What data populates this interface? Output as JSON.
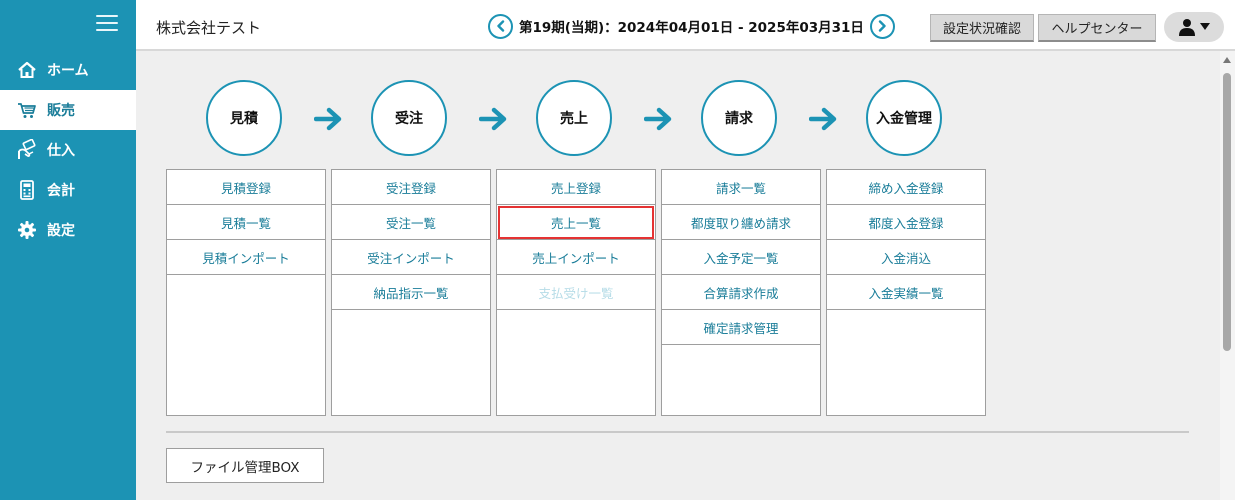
{
  "sidebar": {
    "items": [
      {
        "label": "ホーム",
        "icon": "home-icon",
        "active": false
      },
      {
        "label": "販売",
        "icon": "cart-icon",
        "active": true
      },
      {
        "label": "仕入",
        "icon": "purchase-icon",
        "active": false
      },
      {
        "label": "会計",
        "icon": "calculator-icon",
        "active": false
      },
      {
        "label": "設定",
        "icon": "gear-icon",
        "active": false
      }
    ]
  },
  "header": {
    "company": "株式会社テスト",
    "period": "第19期(当期)：2024年04月01日 - 2025年03月31日",
    "settings_button": "設定状況確認",
    "help_button": "ヘルプセンター"
  },
  "flow": {
    "steps": [
      "見積",
      "受注",
      "売上",
      "請求",
      "入金管理"
    ]
  },
  "columns": [
    {
      "items": [
        {
          "label": "見積登録"
        },
        {
          "label": "見積一覧"
        },
        {
          "label": "見積インポート"
        }
      ]
    },
    {
      "items": [
        {
          "label": "受注登録"
        },
        {
          "label": "受注一覧"
        },
        {
          "label": "受注インポート"
        },
        {
          "label": "納品指示一覧"
        }
      ]
    },
    {
      "items": [
        {
          "label": "売上登録"
        },
        {
          "label": "売上一覧"
        },
        {
          "label": "売上インポート"
        },
        {
          "label": "支払受け一覧"
        }
      ]
    },
    {
      "items": [
        {
          "label": "請求一覧"
        },
        {
          "label": "都度取り纏め請求"
        },
        {
          "label": "入金予定一覧"
        },
        {
          "label": "合算請求作成"
        },
        {
          "label": "確定請求管理"
        }
      ]
    },
    {
      "items": [
        {
          "label": "締め入金登録"
        },
        {
          "label": "都度入金登録"
        },
        {
          "label": "入金消込"
        },
        {
          "label": "入金実績一覧"
        }
      ]
    }
  ],
  "file_button": "ファイル管理BOX",
  "colors": {
    "accent": "#1c93b4",
    "link": "#1a7d99",
    "highlight": "#e53333"
  }
}
